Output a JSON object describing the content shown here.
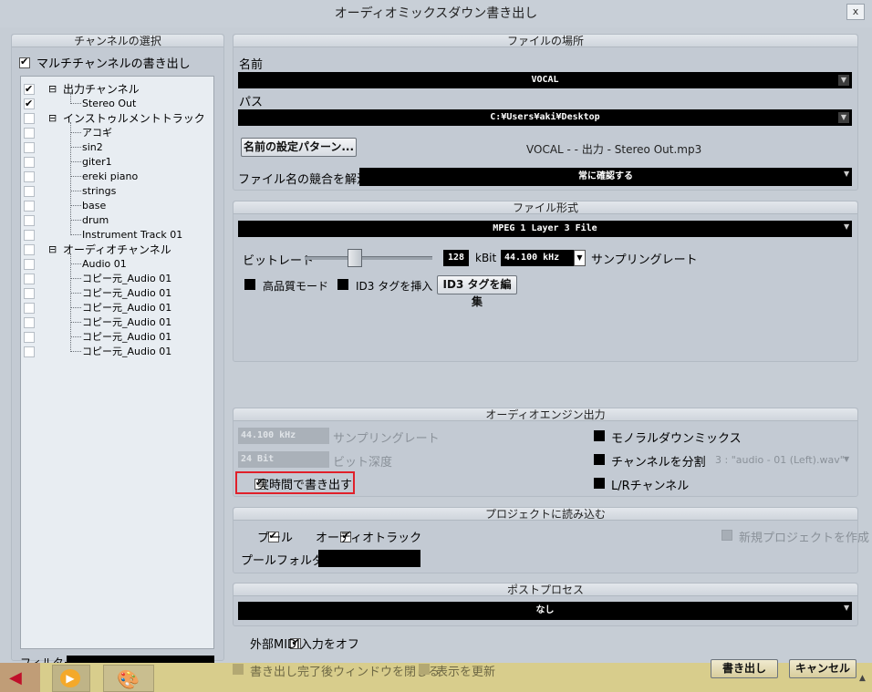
{
  "window": {
    "title": "オーディオミックスダウン書き出し",
    "close_glyph": "x"
  },
  "channel_panel": {
    "header": "チャンネルの選択",
    "multichannel_label": "マルチチャンネルの書き出し",
    "tree": [
      {
        "label": "出力チャンネル",
        "level": 0,
        "checked": true,
        "expander": "⊟"
      },
      {
        "label": "Stereo Out",
        "level": 1,
        "checked": true
      },
      {
        "label": "インストゥルメントトラック",
        "level": 0,
        "checked": false,
        "expander": "⊟"
      },
      {
        "label": "アコギ",
        "level": 1,
        "checked": false
      },
      {
        "label": "sin2",
        "level": 1,
        "checked": false
      },
      {
        "label": "giter1",
        "level": 1,
        "checked": false
      },
      {
        "label": "ereki piano",
        "level": 1,
        "checked": false
      },
      {
        "label": "strings",
        "level": 1,
        "checked": false
      },
      {
        "label": "base",
        "level": 1,
        "checked": false
      },
      {
        "label": "drum",
        "level": 1,
        "checked": false
      },
      {
        "label": "Instrument Track 01",
        "level": 1,
        "checked": false
      },
      {
        "label": "オーディオチャンネル",
        "level": 0,
        "checked": false,
        "expander": "⊟"
      },
      {
        "label": "Audio 01",
        "level": 1,
        "checked": false
      },
      {
        "label": "コピー元_Audio 01",
        "level": 1,
        "checked": false
      },
      {
        "label": "コピー元_Audio 01",
        "level": 1,
        "checked": false
      },
      {
        "label": "コピー元_Audio 01",
        "level": 1,
        "checked": false
      },
      {
        "label": "コピー元_Audio 01",
        "level": 1,
        "checked": false
      },
      {
        "label": "コピー元_Audio 01",
        "level": 1,
        "checked": false
      },
      {
        "label": "コピー元_Audio 01",
        "level": 1,
        "checked": false
      }
    ],
    "filter_label": "フィルター"
  },
  "file_location": {
    "header": "ファイルの場所",
    "name_label": "名前",
    "name_value": "VOCAL",
    "path_label": "パス",
    "path_value": "C:¥Users¥aki¥Desktop",
    "naming_button": "名前の設定パターン...",
    "filename_preview": "VOCAL - - 出力 - Stereo Out.mp3",
    "conflict_label": "ファイル名の競合を解決",
    "conflict_value": "常に確認する"
  },
  "file_format": {
    "header": "ファイル形式",
    "format_value": "MPEG 1 Layer 3 File",
    "bitrate_label": "ビットレート",
    "bitrate_value": "128",
    "bitrate_unit": "kBit",
    "bitrate_fraction": 0.38,
    "samplerate_value": "44.100 kHz",
    "samplerate_label": "サンプリングレート",
    "hq_label": "高品質モード",
    "id3_label": "ID3 タグを挿入",
    "id3_edit_button": "ID3 タグを編集"
  },
  "engine_output": {
    "header": "オーディオエンジン出力",
    "samplerate_value": "44.100 kHz",
    "samplerate_label": "サンプリングレート",
    "bitdepth_value": "24 Bit",
    "bitdepth_label": "ビット深度",
    "realtime_label": "実時間で書き出す",
    "mono_label": "モノラルダウンミックス",
    "split_label": "チャンネルを分割",
    "split_value": "3 : \"audio - 01 (Left).wav\"",
    "lr_label": "L/Rチャンネル"
  },
  "import_project": {
    "header": "プロジェクトに読み込む",
    "pool_label": "プール",
    "audio_track_label": "オーディオトラック",
    "new_project_label": "新規プロジェクトを作成",
    "pool_folder_label": "プールフォルダー"
  },
  "post_process": {
    "header": "ポストプロセス",
    "value": "なし"
  },
  "bottom": {
    "midi_off_label": "外部MIDI入力をオフ",
    "close_after_label": "書き出し完了後ウィンドウを閉じる",
    "update_display_label": "表示を更新",
    "export_button": "書き出し",
    "cancel_button": "キャンセル"
  },
  "colors": {
    "highlight": "#e0202a",
    "taskbar": "#d8cd8c",
    "panel": "#c3cad3"
  }
}
